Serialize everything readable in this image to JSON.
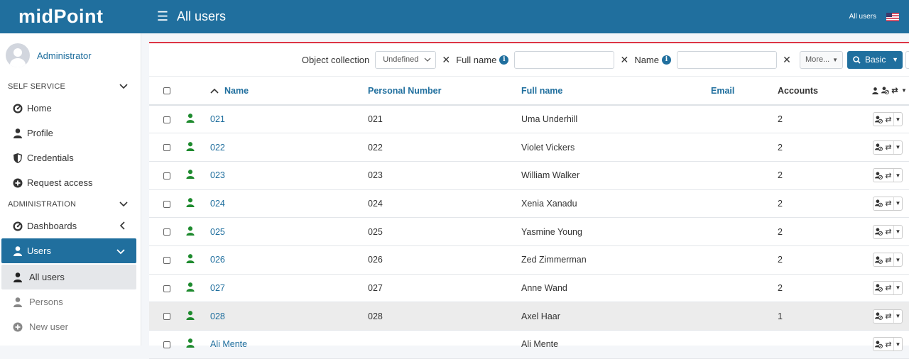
{
  "app": {
    "logo": "midPoint",
    "page_title": "All users",
    "user_link": "All users"
  },
  "sidebar": {
    "profile_name": "Administrator",
    "self_service_label": "SELF SERVICE",
    "self_service_items": [
      {
        "label": "Home",
        "icon": "dashboard-gauge-icon"
      },
      {
        "label": "Profile",
        "icon": "user-icon"
      },
      {
        "label": "Credentials",
        "icon": "shield-icon"
      },
      {
        "label": "Request access",
        "icon": "plus-circle-icon"
      }
    ],
    "administration_label": "ADMINISTRATION",
    "admin_items": {
      "dashboards": "Dashboards",
      "users": "Users",
      "all_users": "All users",
      "persons": "Persons",
      "new_user": "New user"
    }
  },
  "filters": {
    "object_collection_label": "Object collection",
    "object_collection_value": "Undefined",
    "full_name_label": "Full name",
    "name_label": "Name",
    "more_label": "More...",
    "basic_label": "Basic"
  },
  "table": {
    "columns": {
      "name": "Name",
      "personal_number": "Personal Number",
      "full_name": "Full name",
      "email": "Email",
      "accounts": "Accounts"
    },
    "rows": [
      {
        "name": "021",
        "personal_number": "021",
        "full_name": "Uma Underhill",
        "email": "",
        "accounts": "2"
      },
      {
        "name": "022",
        "personal_number": "022",
        "full_name": "Violet Vickers",
        "email": "",
        "accounts": "2"
      },
      {
        "name": "023",
        "personal_number": "023",
        "full_name": "William Walker",
        "email": "",
        "accounts": "2"
      },
      {
        "name": "024",
        "personal_number": "024",
        "full_name": "Xenia Xanadu",
        "email": "",
        "accounts": "2"
      },
      {
        "name": "025",
        "personal_number": "025",
        "full_name": "Yasmine Young",
        "email": "",
        "accounts": "2"
      },
      {
        "name": "026",
        "personal_number": "026",
        "full_name": "Zed Zimmerman",
        "email": "",
        "accounts": "2"
      },
      {
        "name": "027",
        "personal_number": "027",
        "full_name": "Anne Wand",
        "email": "",
        "accounts": "2"
      },
      {
        "name": "028",
        "personal_number": "028",
        "full_name": "Axel Haar",
        "email": "",
        "accounts": "1"
      },
      {
        "name": "Ali Mente",
        "personal_number": "",
        "full_name": "Ali Mente",
        "email": "",
        "accounts": ""
      }
    ]
  },
  "colors": {
    "brand": "#206f9e",
    "user_icon_green": "#1e8a2e",
    "accent_red": "#dc3545"
  }
}
